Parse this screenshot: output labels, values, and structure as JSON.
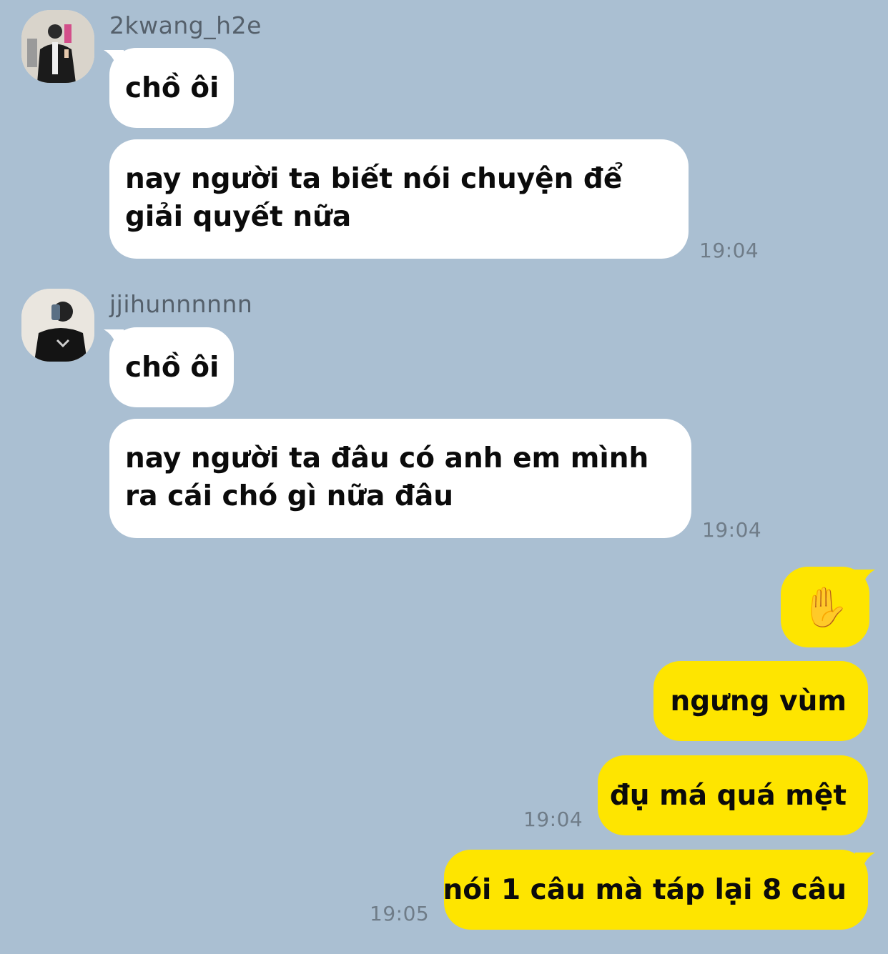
{
  "messages": [
    {
      "sender": "2kwang_h2e",
      "texts": [
        "chồ ôi",
        "nay người ta biết nói chuyện để giải quyết nữa"
      ],
      "time": "19:04"
    },
    {
      "sender": "jjihunnnnnn",
      "texts": [
        "chồ ôi",
        "nay người ta đâu có anh em mình ra cái chó gì nữa đâu"
      ],
      "time": "19:04"
    }
  ],
  "outgoing": [
    {
      "text": "✋",
      "icon": "raised-hand-emoji"
    },
    {
      "text": "ngưng vùm"
    },
    {
      "text": "đụ má quá mệt",
      "time": "19:04"
    },
    {
      "text": "nói 1 câu mà táp lại 8 câu",
      "time": "19:05"
    }
  ],
  "colors": {
    "background": "#aabfd2",
    "incoming_bubble": "#ffffff",
    "outgoing_bubble": "#fee500",
    "timestamp": "#6f7c88",
    "username": "#55606b"
  }
}
